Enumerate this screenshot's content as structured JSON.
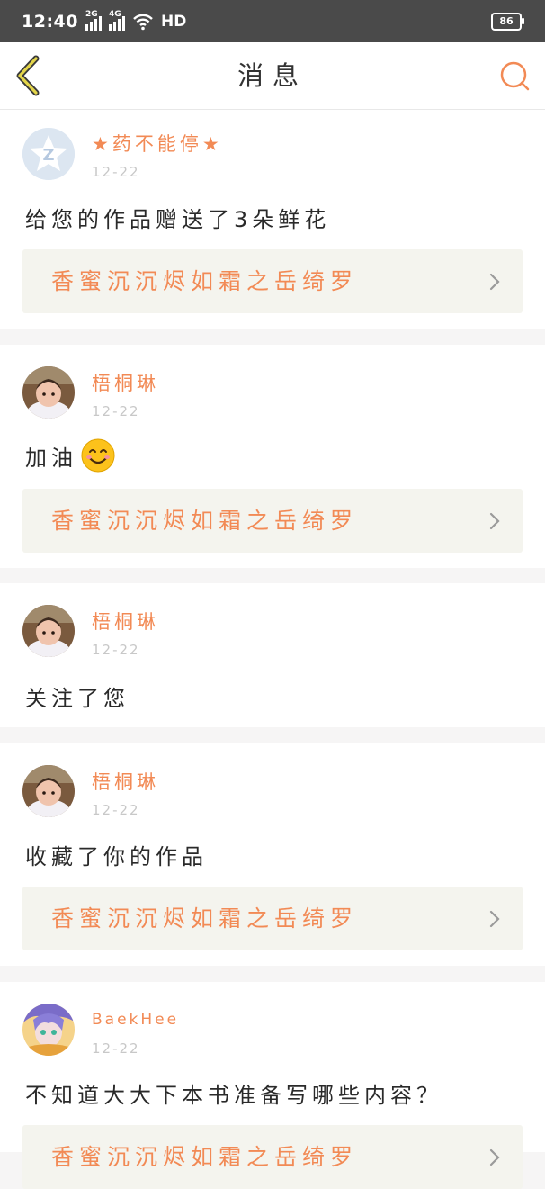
{
  "status_bar": {
    "time": "12:40",
    "sig1": "2G",
    "sig2": "4G",
    "network": "HD",
    "battery": "86"
  },
  "header": {
    "title": "消息"
  },
  "messages": [
    {
      "user": "★药不能停★",
      "date": "12-22",
      "text": "给您的作品赠送了3朵鲜花",
      "work": "香蜜沉沉烬如霜之岳绮罗",
      "avatar": "qq-default-avatar"
    },
    {
      "user": "梧桐琳",
      "date": "12-22",
      "text": "加油",
      "emoji": "smiling-face-emoji",
      "work": "香蜜沉沉烬如霜之岳绮罗",
      "avatar": "baby-photo-avatar"
    },
    {
      "user": "梧桐琳",
      "date": "12-22",
      "text": "关注了您",
      "avatar": "baby-photo-avatar"
    },
    {
      "user": "梧桐琳",
      "date": "12-22",
      "text": "收藏了你的作品",
      "work": "香蜜沉沉烬如霜之岳绮罗",
      "avatar": "baby-photo-avatar"
    },
    {
      "user": "BaekHee",
      "date": "12-22",
      "text": "不知道大大下本书准备写哪些内容？",
      "work": "香蜜沉沉烬如霜之岳绮罗",
      "avatar": "anime-character-avatar"
    }
  ],
  "colors": {
    "accent": "#f28a55",
    "back_arrow": "#e3d54a",
    "card_bg": "#f4f4ee"
  }
}
